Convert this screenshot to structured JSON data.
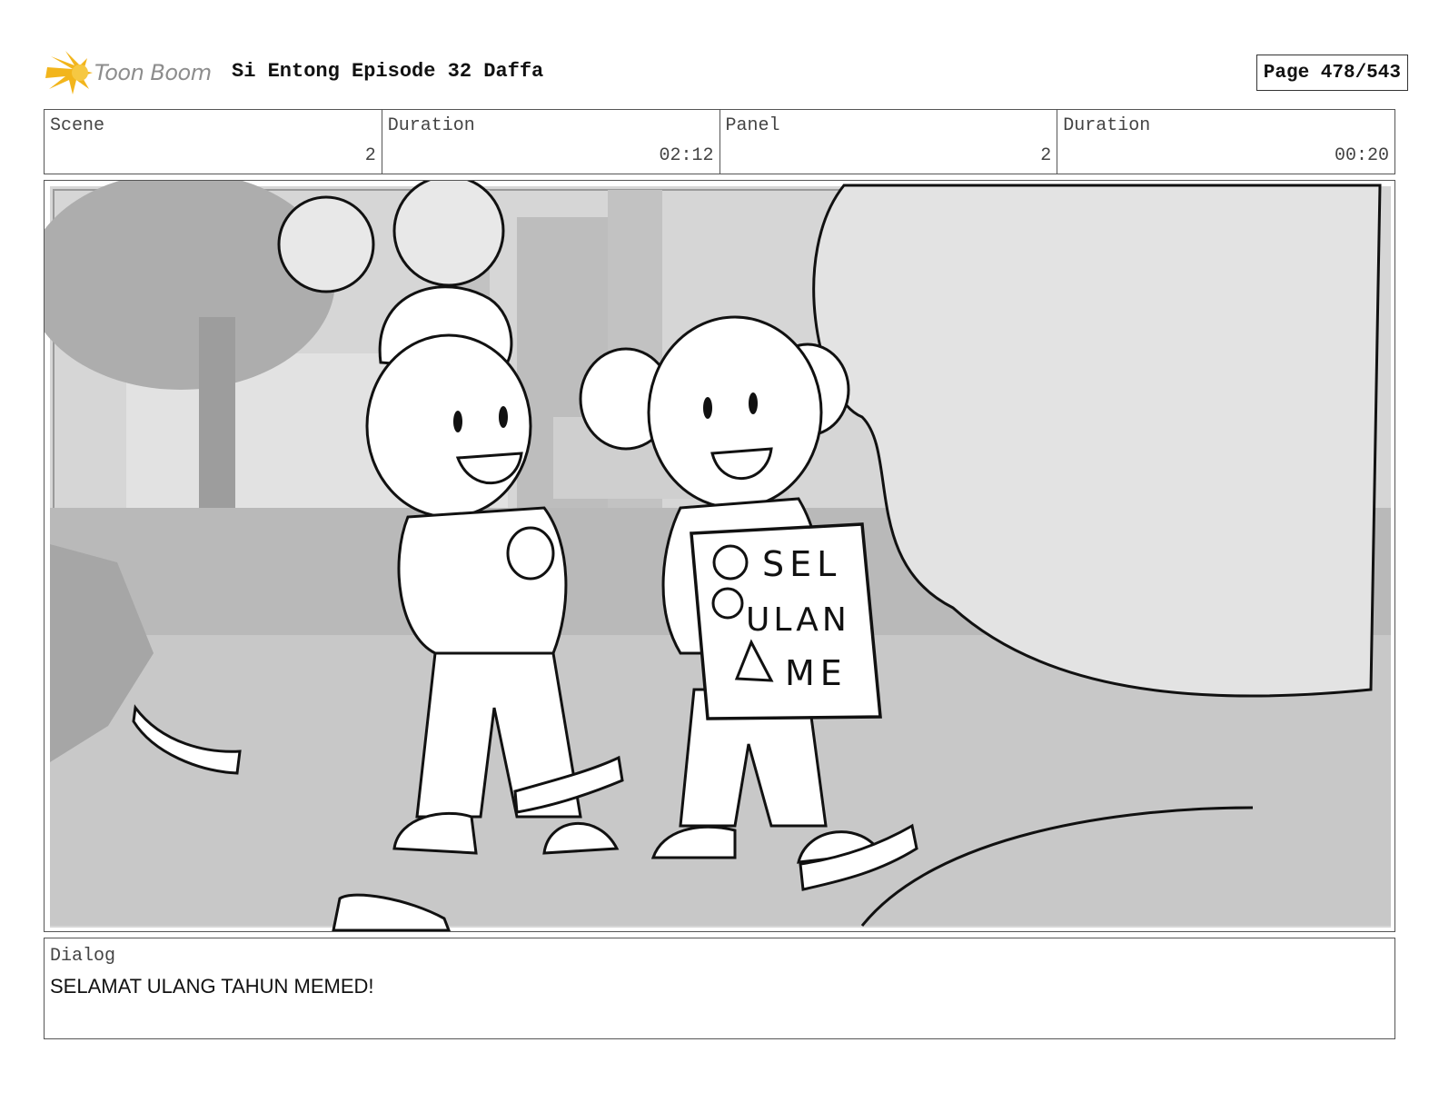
{
  "header": {
    "logo_text": "Toon Boom",
    "title": "Si Entong Episode 32 Daffa",
    "page": "Page 478/543"
  },
  "info": {
    "scene_label": "Scene",
    "scene_value": "2",
    "scene_duration_label": "Duration",
    "scene_duration_value": "02:12",
    "panel_label": "Panel",
    "panel_value": "2",
    "panel_duration_label": "Duration",
    "panel_duration_value": "00:20"
  },
  "panel": {
    "sign_text_line1": "SEL",
    "sign_text_line2": "ULAN",
    "sign_text_line3": "ME"
  },
  "dialog": {
    "label": "Dialog",
    "text": "SELAMAT ULANG TAHUN MEMED!"
  },
  "colors": {
    "logo_yellow": "#f2b51c",
    "logo_text_gray": "#8d8d8d",
    "border": "#555555",
    "background_gray": "#d9d9d9"
  }
}
